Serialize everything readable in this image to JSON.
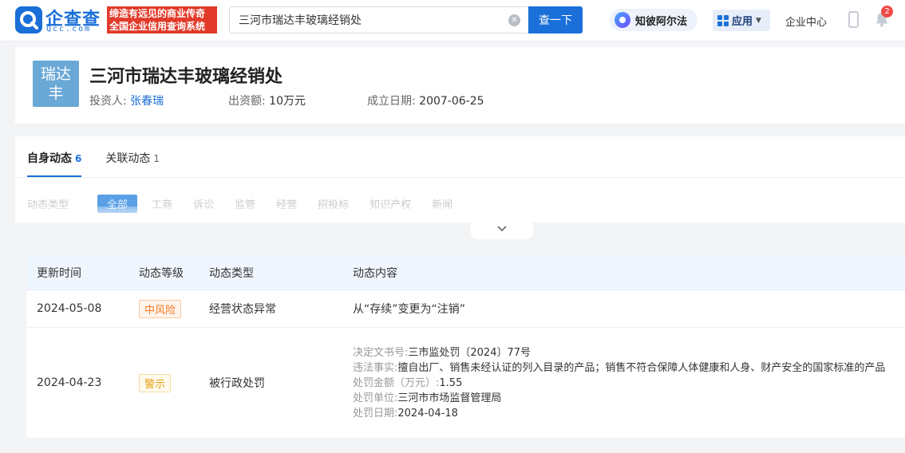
{
  "header": {
    "logo_text": "企查查",
    "logo_sub": "Qcc.com",
    "slogan_line1": "缔造有远见的商业传奇",
    "slogan_line2": "全国企业信用查询系统",
    "search_value": "三河市瑞达丰玻璃经销处",
    "search_button": "查一下",
    "zhibi_label": "知彼阿尔法",
    "apps_label": "应用",
    "enterprise_center": "企业中心",
    "notification_count": "2",
    "icons": [
      "search-clear-icon",
      "alpha-icon",
      "apps-grid-icon",
      "phone-icon",
      "bell-icon"
    ]
  },
  "company": {
    "avatar_line1": "瑞达",
    "avatar_line2": "丰",
    "name": "三河市瑞达丰玻璃经销处",
    "investor_label": "投资人:",
    "investor": "张春瑞",
    "capital_label": "出资额:",
    "capital": "10万元",
    "founded_label": "成立日期:",
    "founded": "2007-06-25"
  },
  "dynamics": {
    "tabs": [
      {
        "label": "自身动态",
        "count": "6"
      },
      {
        "label": "关联动态",
        "count": "1"
      }
    ],
    "filter_label": "动态类型",
    "filters": [
      "全部",
      "工商",
      "诉讼",
      "监管",
      "经营",
      "招投标",
      "知识产权",
      "新闻"
    ]
  },
  "table": {
    "headers": [
      "更新时间",
      "动态等级",
      "动态类型",
      "动态内容"
    ],
    "rows": [
      {
        "date": "2024-05-08",
        "level": "中风险",
        "type": "经营状态异常",
        "content": "从“存续”变更为“注销”"
      },
      {
        "date": "2024-04-23",
        "level": "警示",
        "type": "被行政处罚",
        "details": [
          {
            "k": "决定文书号:",
            "v": "三市监处罚〔2024〕77号"
          },
          {
            "k": "违法事实:",
            "v": "擅自出厂、销售未经认证的列入目录的产品；销售不符合保障人体健康和人身、财产安全的国家标准的产品"
          },
          {
            "k": "处罚金额（万元）:",
            "v": "1.55"
          },
          {
            "k": "处罚单位:",
            "v": "三河市市场监督管理局"
          },
          {
            "k": "处罚日期:",
            "v": "2024-04-18"
          }
        ]
      }
    ]
  }
}
